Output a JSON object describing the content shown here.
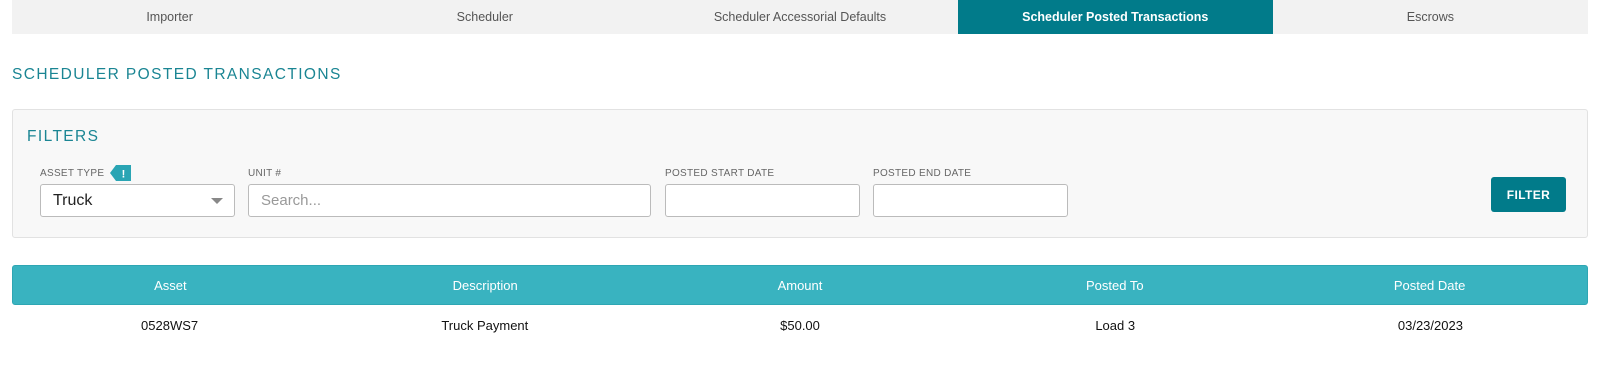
{
  "tabs": [
    {
      "label": "Importer",
      "active": false
    },
    {
      "label": "Scheduler",
      "active": false
    },
    {
      "label": "Scheduler Accessorial Defaults",
      "active": false
    },
    {
      "label": "Scheduler Posted Transactions",
      "active": true
    },
    {
      "label": "Escrows",
      "active": false
    }
  ],
  "page_title": "SCHEDULER POSTED TRANSACTIONS",
  "filters": {
    "title": "FILTERS",
    "asset_type": {
      "label": "ASSET TYPE",
      "value": "Truck",
      "info_glyph": "!"
    },
    "unit": {
      "label": "UNIT #",
      "placeholder": "Search...",
      "value": ""
    },
    "posted_start": {
      "label": "POSTED START DATE",
      "value": ""
    },
    "posted_end": {
      "label": "POSTED END DATE",
      "value": ""
    },
    "filter_button": "FILTER"
  },
  "table": {
    "headers": [
      "Asset",
      "Description",
      "Amount",
      "Posted To",
      "Posted Date"
    ],
    "rows": [
      {
        "asset": "0528WS7",
        "description": "Truck Payment",
        "amount": "$50.00",
        "posted_to": "Load 3",
        "posted_date": "03/23/2023"
      }
    ]
  },
  "colors": {
    "accent": "#017b8a",
    "header": "#39b3c0",
    "title": "#1a8593"
  },
  "icons": {
    "info": "exclamation-tag-icon",
    "dropdown": "chevron-down-icon"
  }
}
